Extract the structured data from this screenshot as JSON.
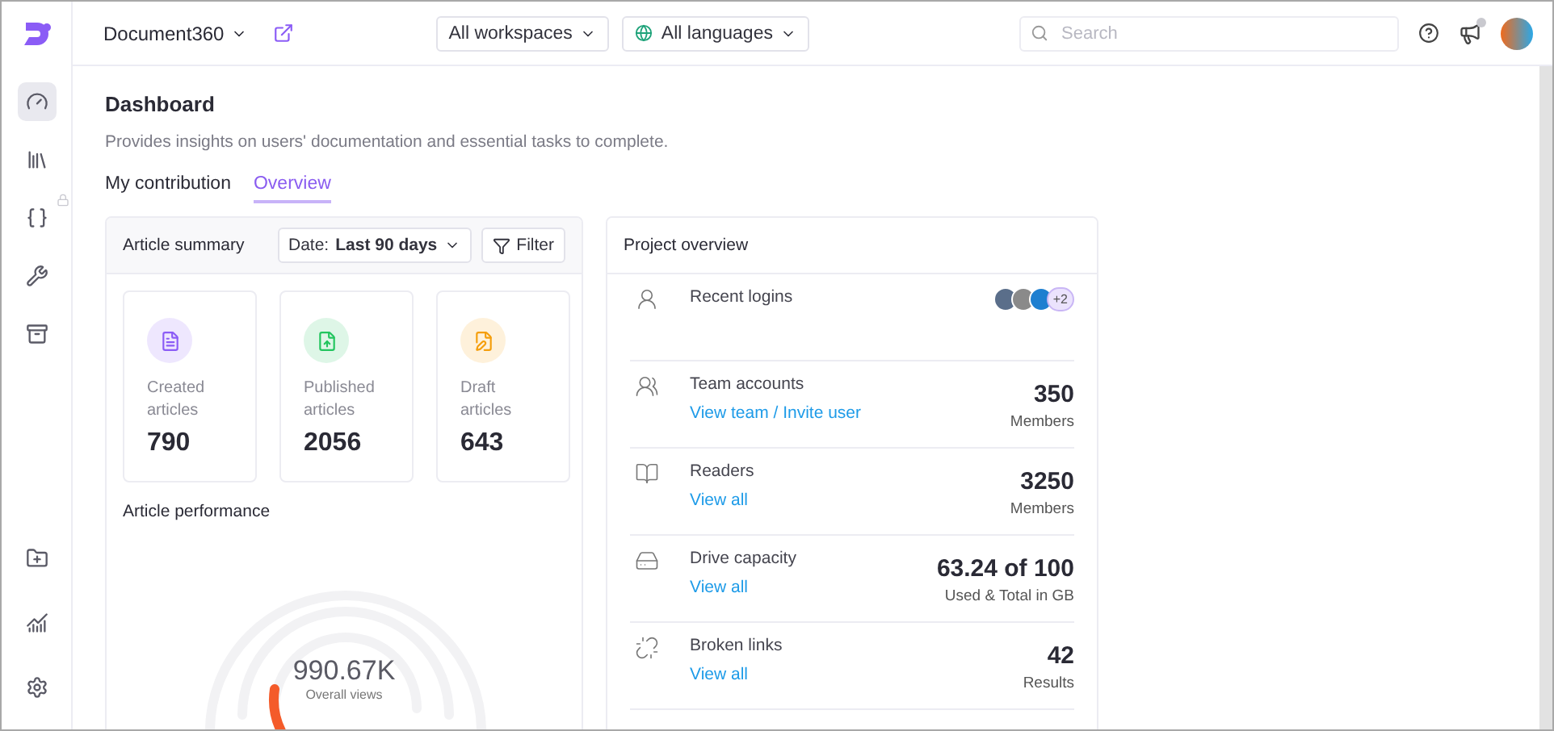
{
  "sidebar": {
    "items": [
      {
        "selected": true,
        "locked": false
      },
      {
        "selected": false,
        "locked": false
      },
      {
        "selected": false,
        "locked": true
      },
      {
        "selected": false,
        "locked": false
      },
      {
        "selected": false,
        "locked": false
      }
    ],
    "bottom_items": [
      {
        "selected": false
      },
      {
        "selected": false
      },
      {
        "selected": false
      }
    ]
  },
  "topbar": {
    "project": "Document360",
    "workspace": "All workspaces",
    "language": "All languages",
    "search": {
      "placeholder": "Search"
    },
    "notification_dot": true
  },
  "page": {
    "title": "Dashboard",
    "subtitle": "Provides insights on users' documentation and essential tasks to complete."
  },
  "tabs": [
    {
      "label": "My contribution",
      "selected": false
    },
    {
      "label": "Overview",
      "selected": true
    }
  ],
  "article_summary": {
    "title": "Article summary",
    "date_label": "Date:",
    "date_value": "Last 90 days",
    "filter": "Filter",
    "stats": [
      {
        "label": "Created articles",
        "value": "790",
        "color": "#8b5cf6"
      },
      {
        "label": "Published articles",
        "value": "2056",
        "color": "#22c55e"
      },
      {
        "label": "Draft articles",
        "value": "643",
        "color": "#f59e0b"
      }
    ]
  },
  "article_performance": {
    "title": "Article performance",
    "value": "990.67K",
    "caption": "Overall views"
  },
  "project_overview": {
    "title": "Project overview",
    "rows": [
      {
        "kind": "avatars",
        "label": "Recent logins",
        "more": "+2"
      },
      {
        "kind": "metric",
        "label": "Team accounts",
        "link": "View team / Invite user",
        "value": "350",
        "unit": "Members"
      },
      {
        "kind": "metric",
        "label": "Readers",
        "link": "View all",
        "value": "3250",
        "unit": "Members"
      },
      {
        "kind": "metric",
        "label": "Drive capacity",
        "link": "View all",
        "value": "63.24 of 100",
        "unit": "Used & Total in GB"
      },
      {
        "kind": "metric",
        "label": "Broken links",
        "link": "View all",
        "value": "42",
        "unit": "Results"
      }
    ]
  }
}
